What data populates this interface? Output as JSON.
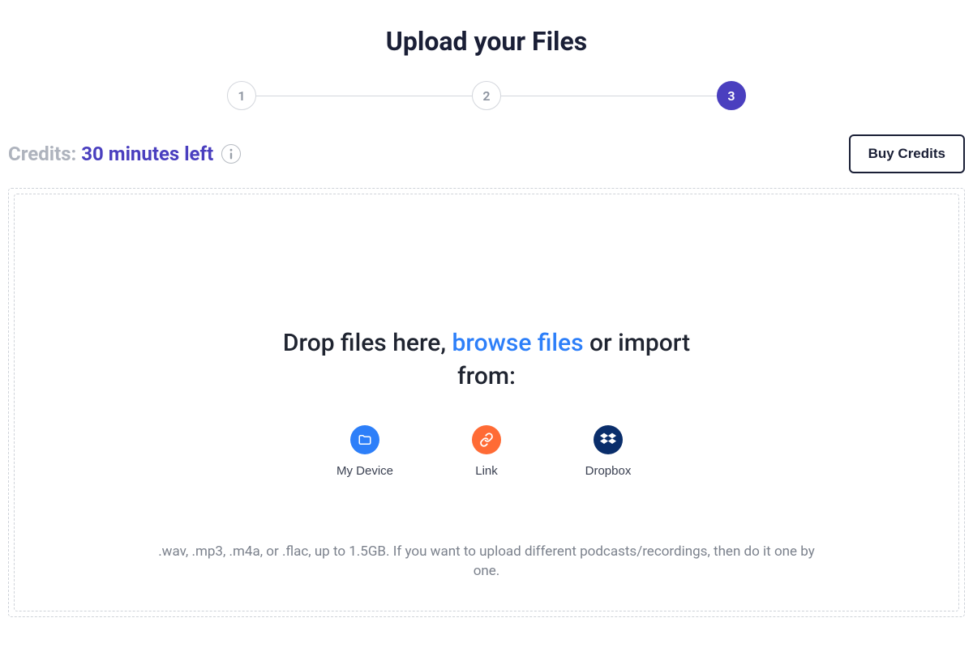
{
  "title": "Upload your Files",
  "stepper": {
    "steps": [
      "1",
      "2",
      "3"
    ],
    "active_index": 2
  },
  "credits": {
    "label": "Credits:",
    "value": "30 minutes left"
  },
  "buy_credits_label": "Buy Credits",
  "dropzone": {
    "prompt_prefix": "Drop files here, ",
    "browse_label": "browse files",
    "prompt_suffix": " or import from:",
    "sources": [
      {
        "id": "my-device",
        "label": "My Device",
        "icon": "folder-icon"
      },
      {
        "id": "link",
        "label": "Link",
        "icon": "link-icon"
      },
      {
        "id": "dropbox",
        "label": "Dropbox",
        "icon": "dropbox-icon"
      }
    ],
    "hint": ".wav, .mp3, .m4a, or .flac, up to 1.5GB. If you want to upload different podcasts/recordings, then do it one by one."
  }
}
